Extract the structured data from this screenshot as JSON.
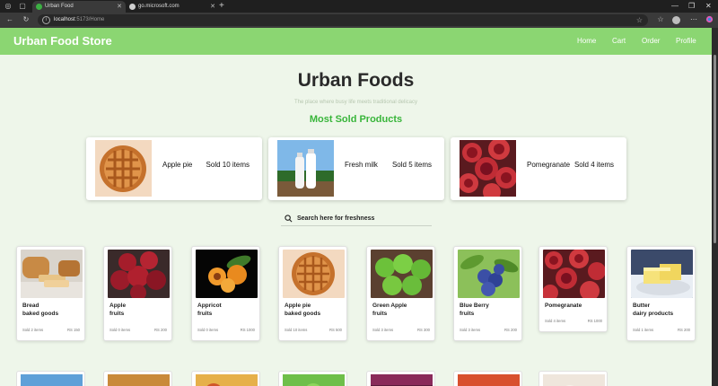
{
  "browser": {
    "tabs": [
      {
        "title": "Urban Food",
        "favicon_color": "#3cb043"
      },
      {
        "title": "go.microsoft.com",
        "favicon_color": "#cfcfcf"
      }
    ],
    "url_host": "localhost",
    "url_path": ":5173/Home"
  },
  "site": {
    "brand": "Urban Food Store",
    "nav": [
      "Home",
      "Cart",
      "Order",
      "Profile"
    ],
    "hero_title": "Urban Foods",
    "tagline": "The place where busy life meets traditional delicacy",
    "section_title": "Most Sold Products",
    "search_label": "Search here for freshness"
  },
  "colors": {
    "navbar": "#8bd672",
    "page_bg": "#eef6ea",
    "accent": "#38b53a"
  },
  "most_sold": [
    {
      "name": "Apple pie",
      "sold": "Sold 10 items",
      "image": "apple-pie"
    },
    {
      "name": "Fresh milk",
      "sold": "Sold 5 items",
      "image": "milk-bottles"
    },
    {
      "name": "Pomegranate",
      "sold": "Sold 4 items",
      "image": "pomegranate"
    }
  ],
  "products": [
    {
      "name": "Bread",
      "category": "baked goods",
      "sold": "Sold 2 items",
      "price": "RS 150",
      "image": "bread"
    },
    {
      "name": "Apple",
      "category": "fruits",
      "sold": "Sold 0 items",
      "price": "RS 200",
      "image": "red-apples"
    },
    {
      "name": "Appricot",
      "category": "fruits",
      "sold": "Sold 0 items",
      "price": "RS 1000",
      "image": "apricot"
    },
    {
      "name": "Apple pie",
      "category": "baked goods",
      "sold": "Sold 10 items",
      "price": "RS 500",
      "image": "apple-pie"
    },
    {
      "name": "Green Apple",
      "category": "fruits",
      "sold": "Sold 3 items",
      "price": "RS 300",
      "image": "green-apples"
    },
    {
      "name": "Blue Berry",
      "category": "fruits",
      "sold": "Sold 3 items",
      "price": "RS 200",
      "image": "blueberries"
    },
    {
      "name": "Pomegranate",
      "category": "",
      "sold": "Sold 4 items",
      "price": "RS 1000",
      "image": "pomegranate"
    },
    {
      "name": "Butter",
      "category": "dairy products",
      "sold": "Sold 1 items",
      "price": "RS 200",
      "image": "butter"
    }
  ]
}
